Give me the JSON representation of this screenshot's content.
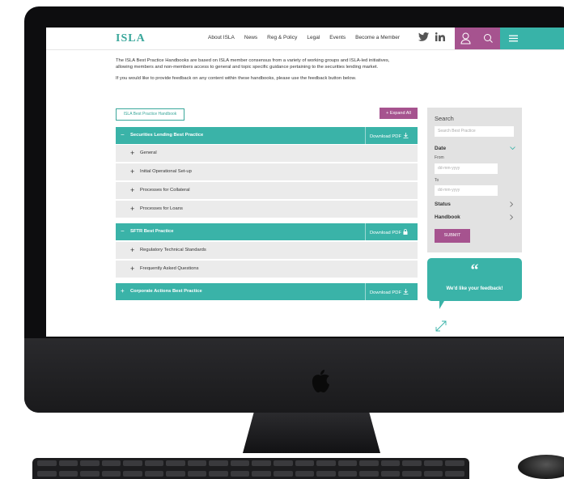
{
  "nav": {
    "logo": "ISLA",
    "menu": [
      "About ISLA",
      "News",
      "Reg & Policy",
      "Legal",
      "Events",
      "Become a Member"
    ]
  },
  "intro": {
    "p1": "The ISLA Best Practice Handbooks are based on ISLA member consensus from a variety of working groups and ISLA-led initiatives, allowing members and non-members access to general and topic specific guidance pertaining to the securities lending market.",
    "p2": "If you would like to provide feedback on any content within these handbooks, please use the feedback button below."
  },
  "handbook_label": "ISLA Best Practice Handbook",
  "expand_all": "Expand All",
  "sections": [
    {
      "title": "Securities Lending Best Practice",
      "sign": "−",
      "download": "Download PDF",
      "icon": "download-icon",
      "items": [
        "General",
        "Initial Operational Set-up",
        "Processes for Collateral",
        "Processes for Loans"
      ]
    },
    {
      "title": "SFTR Best Practice",
      "sign": "−",
      "download": "Download PDF",
      "icon": "lock-icon",
      "items": [
        "Regulatory Technical Standards",
        "Frequently Asked Questions"
      ]
    },
    {
      "title": "Corporate Actions Best Practice",
      "sign": "+",
      "download": "Download PDF",
      "icon": "download-icon",
      "items": []
    }
  ],
  "item_sign": "+",
  "sidebar": {
    "heading": "Search",
    "search_placeholder": "Search Best Practice",
    "date_label": "Date",
    "from_label": "From",
    "from_placeholder": "dd-mm-yyyy",
    "to_label": "To",
    "to_placeholder": "dd-mm-yyyy",
    "status_label": "Status",
    "handbook_label": "Handbook",
    "submit": "SUBMIT"
  },
  "feedback": {
    "quote": "“",
    "text": "We'd like your feedback!"
  },
  "colors": {
    "teal": "#3ab3a8",
    "purple": "#a6538f"
  }
}
